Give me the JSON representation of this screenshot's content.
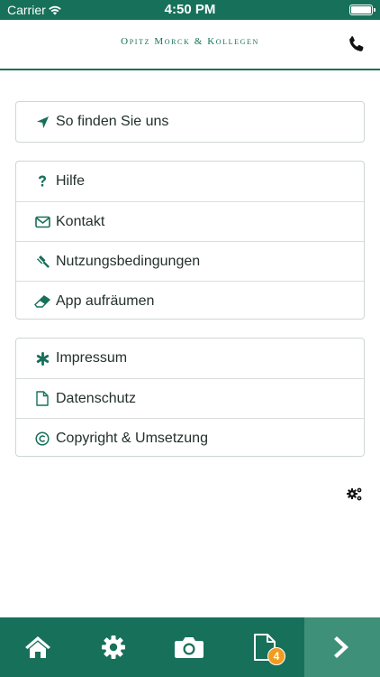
{
  "status_bar": {
    "carrier": "Carrier",
    "time": "4:50 PM"
  },
  "header": {
    "brand": "Opitz Morck & Kollegen",
    "phone_icon": "phone-icon"
  },
  "menu_groups": [
    {
      "items": [
        {
          "label": "So finden Sie uns",
          "icon": "location-arrow-icon"
        }
      ]
    },
    {
      "items": [
        {
          "label": "Hilfe",
          "icon": "question-icon"
        },
        {
          "label": "Kontakt",
          "icon": "envelope-icon"
        },
        {
          "label": "Nutzungsbedingungen",
          "icon": "gavel-icon"
        },
        {
          "label": "App aufräumen",
          "icon": "eraser-icon"
        }
      ]
    },
    {
      "items": [
        {
          "label": "Impressum",
          "icon": "asterisk-icon"
        },
        {
          "label": "Datenschutz",
          "icon": "document-icon"
        },
        {
          "label": "Copyright & Umsetzung",
          "icon": "copyright-icon"
        }
      ]
    }
  ],
  "tab_bar": {
    "tabs": [
      "home-icon",
      "settings-gear-icon",
      "camera-icon",
      "document-icon",
      "chevron-right-icon"
    ],
    "documents_badge": "4"
  },
  "colors": {
    "brand_green": "#17705a",
    "tab_next_green": "#3f9078",
    "badge_orange": "#f29c1f"
  }
}
